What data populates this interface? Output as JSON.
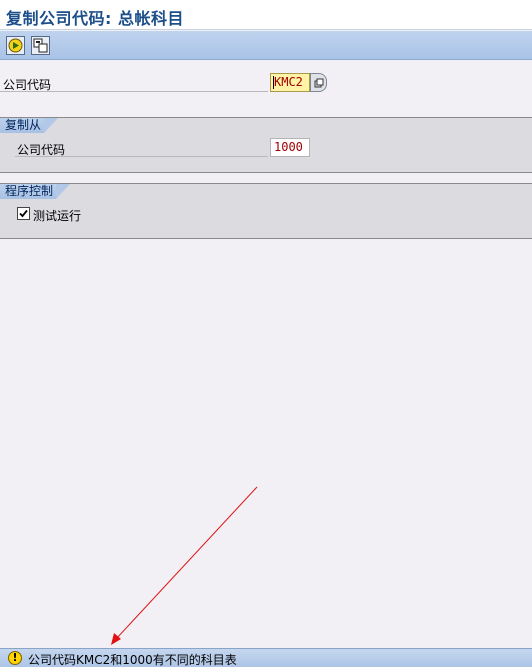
{
  "title": "复制公司代码: 总帐科目",
  "toolbar": {
    "execute_icon": "execute-icon",
    "multi_copy_icon": "multiple-selection-icon"
  },
  "target": {
    "label": "公司代码",
    "value": "KMC2"
  },
  "copy_from": {
    "group_title": "复制从",
    "label": "公司代码",
    "value": "1000"
  },
  "program_control": {
    "group_title": "程序控制",
    "test_run_label": "测试运行",
    "test_run_checked": true
  },
  "status": {
    "type": "warning",
    "message": "公司代码KMC2和1000有不同的科目表"
  }
}
